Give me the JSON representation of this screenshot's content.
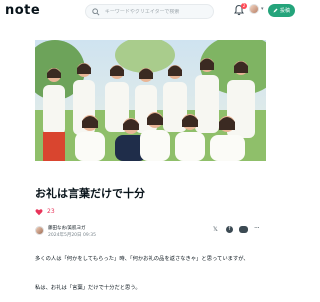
{
  "header": {
    "logo": "note",
    "search_placeholder": "キーワードやクリエイターで検索",
    "notification_count": "2",
    "post_button_label": "投稿"
  },
  "article": {
    "title": "お礼は言葉だけで十分",
    "like_count": "23",
    "author_name": "藤田なお/美肌ヨガ",
    "date": "2024年5月20日 09:35",
    "paragraphs": [
      "多くの人は「何かをしてもらった」時、「何かお礼の品を返さなきゃ」と思っていますが、",
      "私は、お礼は「言葉」だけで十分だと思う。"
    ]
  },
  "colors": {
    "accent": "#24a47b",
    "like": "#e8345a",
    "text": "#08131a"
  },
  "icons": [
    "search-icon",
    "bell-icon",
    "heart-icon",
    "x-icon",
    "facebook-icon",
    "line-icon",
    "more-icon"
  ]
}
